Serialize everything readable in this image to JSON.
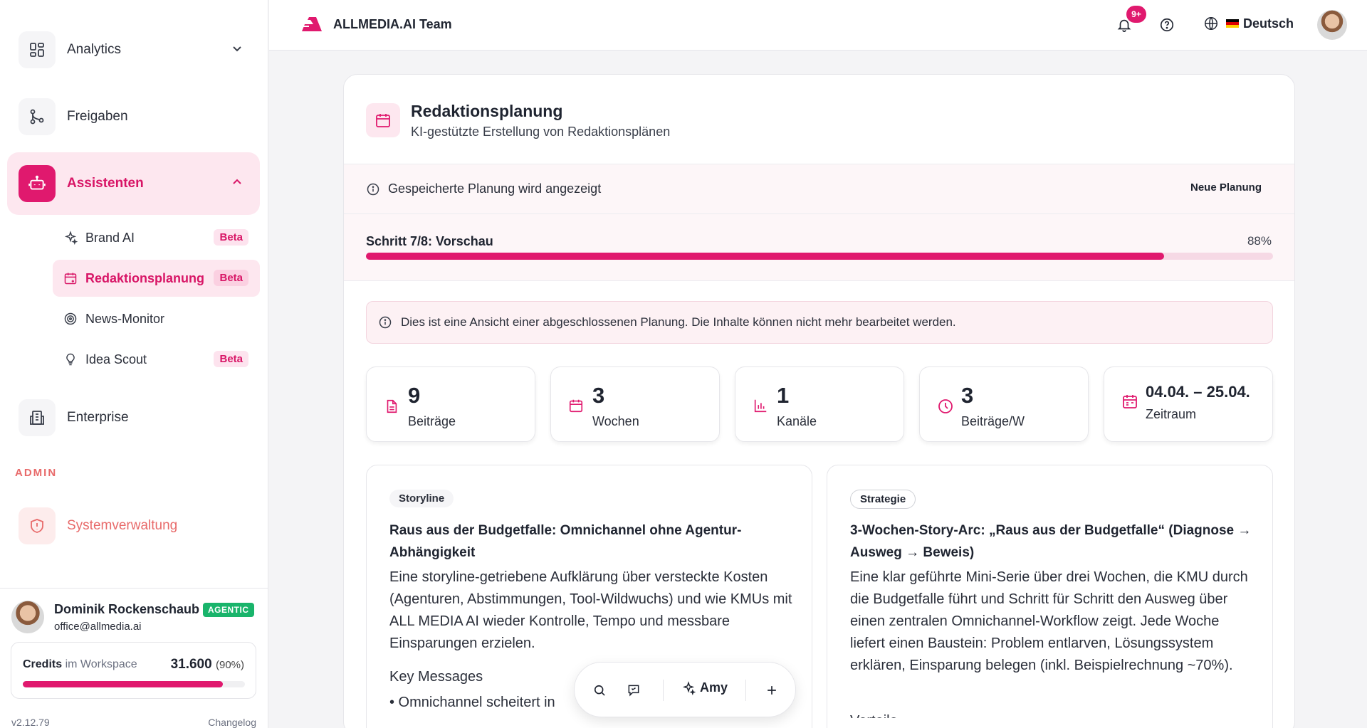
{
  "sidebar": {
    "nav": {
      "analytics": "Analytics",
      "freigaben": "Freigaben",
      "assistenten": "Assistenten",
      "enterprise": "Enterprise",
      "systemverwaltung": "Systemverwaltung"
    },
    "assistants": [
      {
        "label": "Brand AI",
        "badge": "Beta"
      },
      {
        "label": "Redaktionsplanung",
        "badge": "Beta"
      },
      {
        "label": "News-Monitor",
        "badge": ""
      },
      {
        "label": "Idea Scout",
        "badge": "Beta"
      }
    ],
    "admin_title": "ADMIN",
    "user": {
      "name": "Dominik Rockenschaub",
      "badge": "AGENTIC",
      "email": "office@allmedia.ai"
    },
    "credits": {
      "label": "Credits",
      "sub": "im Workspace",
      "value": "31.600",
      "pct_text": "(90%)",
      "fraction": 0.9
    },
    "version": "v2.12.79",
    "changelog": "Changelog"
  },
  "topbar": {
    "brand": "ALLMEDIA.AI Team",
    "notifications": "9+",
    "language": "Deutsch"
  },
  "card": {
    "title": "Redaktionsplanung",
    "subtitle": "KI-gestützte Erstellung von Redaktionsplänen",
    "saved_notice": "Gespeicherte Planung wird angezeigt",
    "new_plan": "Neue Planung",
    "step_label": "Schritt 7/8: Vorschau",
    "step_pct": "88%",
    "step_fraction": 0.88,
    "info": "Dies ist eine Ansicht einer abgeschlossenen Planung. Die Inhalte können nicht mehr bearbeitet werden.",
    "stats": [
      {
        "value": "9",
        "label": "Beiträge"
      },
      {
        "value": "3",
        "label": "Wochen"
      },
      {
        "value": "1",
        "label": "Kanäle"
      },
      {
        "value": "3",
        "label": "Beiträge/W"
      },
      {
        "value": "04.04. – 25.04.",
        "label": "Zeitraum"
      }
    ],
    "storyline": {
      "tag": "Storyline",
      "title": "Raus aus der Budgetfalle: Omnichannel ohne Agentur-Abhängigkeit",
      "body": "Eine storyline-getriebene Aufklärung über versteckte Kosten (Agenturen, Abstimmungen, Tool-Wildwuchs) und wie KMUs mit ALL MEDIA AI wieder Kontrolle, Tempo und messbare Einsparungen erzielen.",
      "key_messages": "Key Messages",
      "first_message": "• Omnichannel scheitert in"
    },
    "strategie": {
      "tag": "Strategie",
      "title": "3-Wochen-Story-Arc: „Raus aus der Budgetfalle“ (Diagnose → Ausweg → Beweis)",
      "body": "Eine klar geführte Mini-Serie über drei Wochen, die KMU durch die Budgetfalle führt und Schritt für Schritt den Ausweg über einen zentralen Omnichannel-Workflow zeigt. Jede Woche liefert einen Baustein: Problem entlarven, Lösungssystem erklären, Einsparung belegen (inkl. Beispielrechnung ~70%).",
      "next_heading": "Vorteile"
    }
  },
  "floatbar": {
    "assistant": "Amy"
  },
  "colors": {
    "accent": "#e0196e",
    "admin": "#e86a6a",
    "agentic": "#19b46b"
  }
}
